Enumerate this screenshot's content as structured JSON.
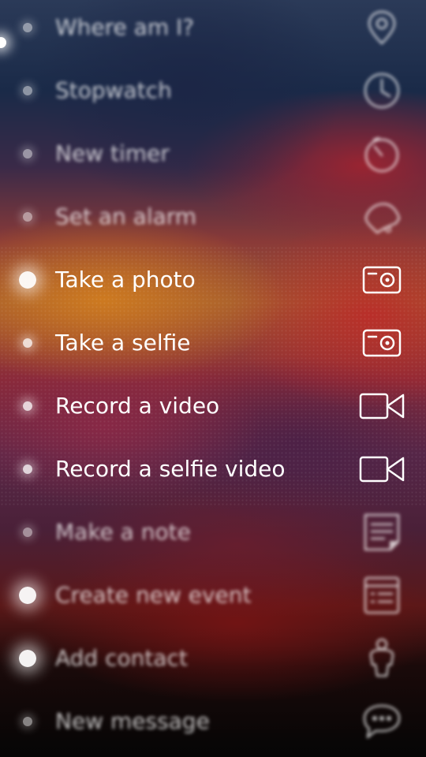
{
  "menu": {
    "items": [
      {
        "label": "Where am I?",
        "icon": "location-pin-icon"
      },
      {
        "label": "Stopwatch",
        "icon": "clock-icon"
      },
      {
        "label": "New timer",
        "icon": "timer-icon"
      },
      {
        "label": "Set an alarm",
        "icon": "alarm-bell-icon"
      },
      {
        "label": "Take a photo",
        "icon": "camera-icon"
      },
      {
        "label": "Take a selfie",
        "icon": "camera-icon"
      },
      {
        "label": "Record a video",
        "icon": "video-camera-icon"
      },
      {
        "label": "Record a selfie video",
        "icon": "video-camera-icon"
      },
      {
        "label": "Make a note",
        "icon": "note-icon"
      },
      {
        "label": "Create new event",
        "icon": "calendar-event-icon"
      },
      {
        "label": "Add contact",
        "icon": "contact-person-icon"
      },
      {
        "label": "New message",
        "icon": "message-bubble-icon"
      }
    ]
  }
}
